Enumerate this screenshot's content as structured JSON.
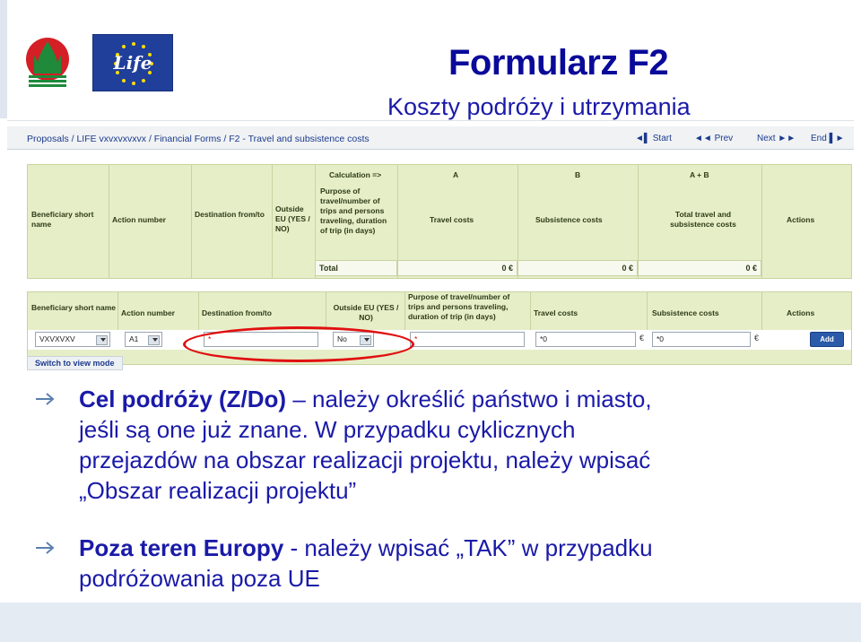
{
  "header": {
    "title": "Formularz F2",
    "subtitle": "Koszty podróży i utrzymania",
    "logo_text": "Life"
  },
  "screenshot": {
    "breadcrumb": "Proposals / LIFE vxvxvxvxvx / Financial Forms / F2 - Travel and subsistence costs",
    "nav": {
      "start": "Start",
      "prev": "Prev",
      "next": "Next",
      "end": "End"
    },
    "table1": {
      "calculation": "Calculation =>",
      "col_a": "A",
      "col_b": "B",
      "col_ab": "A + B",
      "headers": {
        "beneficiary": "Beneficiary short name",
        "action": "Action number",
        "destination": "Destination from/to",
        "outside": "Outside EU (YES / NO)",
        "purpose": "Purpose of travel/number of trips and persons traveling, duration of trip (in days)",
        "travel": "Travel costs",
        "subsistence": "Subsistence costs",
        "total": "Total travel and subsistence costs",
        "actions": "Actions"
      },
      "total_label": "Total",
      "total_a": "0 €",
      "total_b": "0 €",
      "total_ab": "0 €"
    },
    "table2": {
      "headers": {
        "beneficiary": "Beneficiary short name",
        "action": "Action number",
        "destination": "Destination from/to",
        "outside": "Outside EU (YES / NO)",
        "purpose": "Purpose of travel/number of trips and persons traveling, duration of trip (in days)",
        "travel": "Travel costs",
        "subsistence": "Subsistence costs",
        "actions": "Actions"
      },
      "inputs": {
        "beneficiary_value": "VXVXVXV",
        "action_value": "A1",
        "destination_value": "*",
        "outside_value": "No",
        "purpose_value": "*",
        "travel_value": "*0",
        "subsistence_value": "*0",
        "euro": "€",
        "add_label": "Add"
      },
      "switch_label": "Switch to view mode"
    }
  },
  "bullets": [
    {
      "bold": "Cel podróży (Z/Do)",
      "line1_rest": " – należy określić państwo i miasto,",
      "line2": "jeśli są one już znane. W przypadku cyklicznych",
      "line3": "przejazdów na obszar realizacji projektu, należy wpisać",
      "line4": "„Obszar realizacji projektu”"
    },
    {
      "bold": "Poza teren Europy",
      "line1_rest": " - należy wpisać „TAK” w przypadku",
      "line2": "podróżowania poza UE"
    }
  ]
}
